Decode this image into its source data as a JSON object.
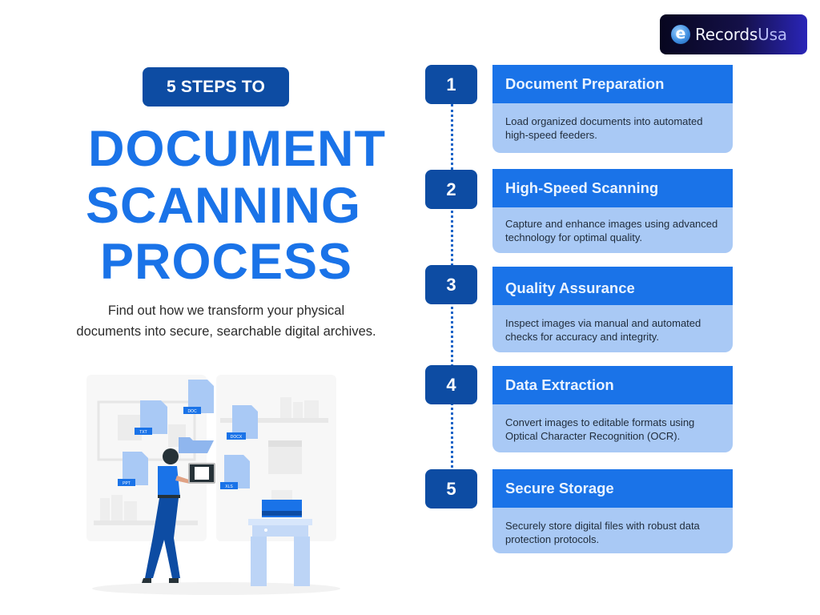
{
  "brand": {
    "logo_badge": "e",
    "logo_text_main": "Records",
    "logo_text_accent": "Usa"
  },
  "header": {
    "pill_label": "5 STEPS TO",
    "title_lines": [
      "DOCUMENT",
      "SCANNING",
      "PROCESS"
    ],
    "subtitle_lines": [
      "Find out how we transform your physical",
      "documents into secure, searchable digital archives."
    ]
  },
  "illustration": {
    "file_tags": [
      "TXT",
      "DOC",
      "DOCX",
      "PPT",
      "XLS"
    ]
  },
  "steps": [
    {
      "number": "1",
      "title": "Document Preparation",
      "description": "Load organized documents into automated high-speed feeders."
    },
    {
      "number": "2",
      "title": "High-Speed Scanning",
      "description": "Capture and enhance images using advanced technology for optimal quality."
    },
    {
      "number": "3",
      "title": "Quality Assurance",
      "description": "Inspect images via manual and automated checks for accuracy and integrity."
    },
    {
      "number": "4",
      "title": "Data Extraction",
      "description": "Convert images to editable formats using Optical Character Recognition (OCR)."
    },
    {
      "number": "5",
      "title": "Secure Storage",
      "description": "Securely store digital files with robust data protection protocols."
    }
  ],
  "colors": {
    "primary": "#1a73e8",
    "dark": "#0d4ca3",
    "light": "#a9c9f5"
  }
}
